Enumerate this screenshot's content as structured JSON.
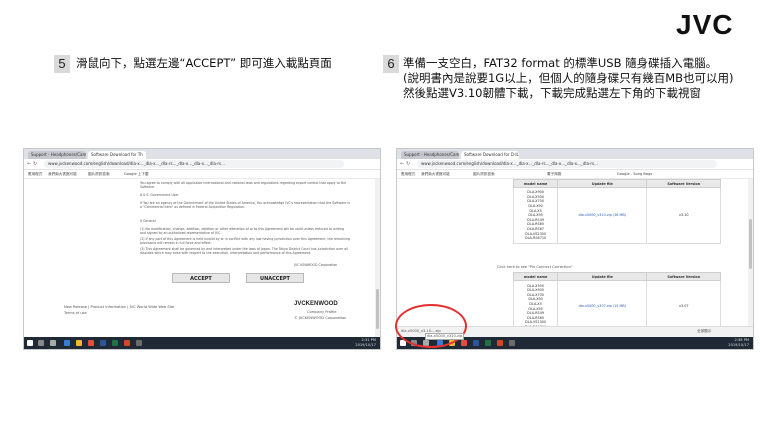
{
  "logo": "JVC",
  "steps": [
    {
      "number": "5",
      "lines": [
        "滑鼠向下，點選左邊“ACCEPT” 即可進入載點頁面"
      ]
    },
    {
      "number": "6",
      "lines": [
        "準備一支空白，FAT32 format 的標準USB 隨身碟插入電腦。",
        "(說明書內是說要1G以上，但個人的隨身碟只有幾百MB也可以用)",
        "然後點選V3.10韌體下載，下載完成點選左下角的下載視窗"
      ]
    }
  ],
  "left_shot": {
    "tabs": [
      "Support - Headphones/Cam",
      "Software Download for Th"
    ],
    "url": "www.jvckenwood.com/english/download/dla-x..._dla-x..._dla-rs..._dla-x..._dla-x..._dla-rs...",
    "bookmarks": [
      "應用程式",
      "我們南大書館可能",
      "圖片資訊檢索",
      "Google 上下載"
    ],
    "paragraphs": [
      "You agree to comply with all applicable international and national laws and regulations regarding export control that apply to the Software.",
      "8 U.S. Government User",
      "If You are an agency of the Government of the United States of America, You acknowledge JVC's representation that the Software is a \"Commercial Item\" as defined in Federal Acquisition Regulation.",
      "9 General",
      "(1) No modification, change, addition, deletion or other alteration of or to this Agreement will be valid unless reduced to writing and signed by an authorized representative of JVC.",
      "(2) If any part of this Agreement is held invalid by or in conflict with any law having jurisdiction over this Agreement, the remaining provisions will remain in full force and effect.",
      "(3) This Agreement shall be governed by and interpreted under the laws of Japan. The Tokyo District Court has jurisdiction over all disputes which may arise with respect to the execution, interpretation and performance of this Agreement."
    ],
    "signature": "JVC KENWOOD Corporation",
    "accept_label": "ACCEPT",
    "unaccept_label": "UNACCEPT",
    "footer_links": [
      "New Release",
      "Product Information",
      "JVC World Wide Web Site",
      "Terms of use"
    ],
    "brand": "JVCKENWOOD",
    "company_profile": "Company Profile",
    "copyright": "© JVCKENWOOD Corporation",
    "clock": [
      "2:31 PM",
      "2019/10/17"
    ]
  },
  "right_shot": {
    "tabs": [
      "Support - Headphones/Cam",
      "Software Download for D-ILA"
    ],
    "url": "www.jvckenwood.com/english/download/dla-x..._dla-x..._dla-rs..._dla-x..._dla-x..._dla-rs...",
    "bookmarks": [
      "應用程式",
      "我們南大書館可能",
      "圖片資訊檢索",
      "電子商務",
      "Google - Song Bags"
    ],
    "table_headers": [
      "model name",
      "Update file",
      "Software Version"
    ],
    "models_top": [
      "DLA-X900",
      "DLA-X500",
      "DLA-X700",
      "DLA-X90",
      "DLA-X5",
      "DLA-X95",
      "DLA-RS49",
      "DLA-RS65",
      "DLA-RS67",
      "DLA-VS2300",
      "DLA-RS6710"
    ],
    "file_top": "dla-x5000_v310.zip (16 MB)",
    "version_top": "v3.10",
    "section_note": "Click here to see \"Pin Connect Correction\"",
    "models_bottom": [
      "DLA-X500",
      "DLA-X900",
      "DLA-X700",
      "DLA-X90",
      "DLA-X5",
      "DLA-X95",
      "DLA-RS49",
      "DLA-RS65",
      "DLA-VS2300",
      "DLA-RS6710"
    ],
    "file_bottom": "dla-x5000_v307.zip (15 MB)",
    "version_bottom": "v3.07",
    "download_item": "dla-x5000_v3.10....zip",
    "download_tooltip": "dla-x5000_v310.zip",
    "show_all": "全部顯示",
    "clock": [
      "2:38 PM",
      "2019/10/17"
    ]
  }
}
